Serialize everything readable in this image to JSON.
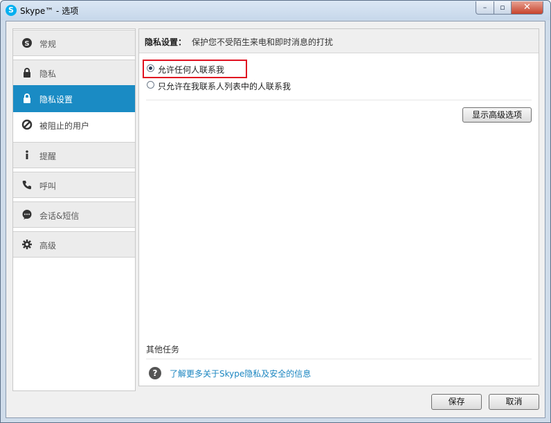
{
  "window": {
    "title": "Skype™ - 选项",
    "app_icon": "S"
  },
  "titlebar": {
    "minimize": "–",
    "maximize": "▫",
    "close": "✕"
  },
  "sidebar": {
    "items": [
      {
        "label": "常规",
        "icon": "skype-icon"
      },
      {
        "label": "隐私",
        "icon": "lock-icon"
      },
      {
        "label": "隐私设置",
        "icon": "lock-icon"
      },
      {
        "label": "被阻止的用户",
        "icon": "block-icon"
      },
      {
        "label": "提醒",
        "icon": "info-icon"
      },
      {
        "label": "呼叫",
        "icon": "phone-icon"
      },
      {
        "label": "会话&短信",
        "icon": "chat-icon"
      },
      {
        "label": "高级",
        "icon": "gear-icon"
      }
    ],
    "active_index": 2
  },
  "panel": {
    "heading": "隐私设置：",
    "description": "保护您不受陌生来电和即时消息的打扰",
    "options": [
      {
        "label": "允许任何人联系我",
        "selected": true
      },
      {
        "label": "只允许在我联系人列表中的人联系我",
        "selected": false
      }
    ],
    "advanced_button": "显示高级选项",
    "other_tasks": "其他任务",
    "help_icon": "?",
    "help_link": "了解更多关于Skype隐私及安全的信息"
  },
  "footer": {
    "save": "保存",
    "cancel": "取消"
  },
  "colors": {
    "accent": "#1a8bc4",
    "highlight": "#e01020",
    "link": "#1a85c0"
  }
}
